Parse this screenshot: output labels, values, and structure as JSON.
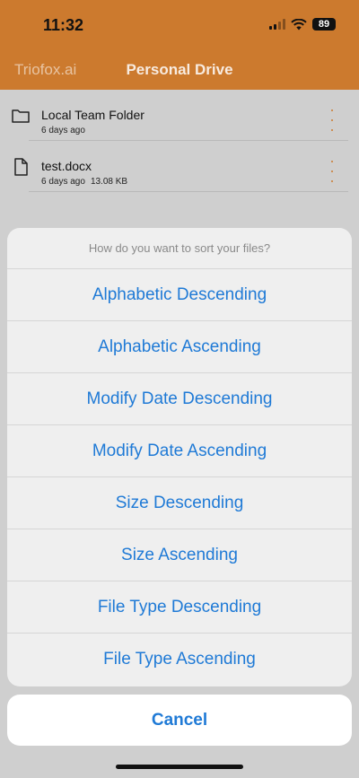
{
  "status_bar": {
    "time": "11:32",
    "battery": "89"
  },
  "nav": {
    "back_label": "Triofox.ai",
    "title": "Personal Drive"
  },
  "files": [
    {
      "name": "Local Team Folder",
      "date": "6 days ago",
      "size": "",
      "icon": "folder-icon"
    },
    {
      "name": "test.docx",
      "date": "6 days ago",
      "size": "13.08 KB",
      "icon": "document-icon"
    }
  ],
  "sort_sheet": {
    "title": "How do you want to sort your files?",
    "options": [
      "Alphabetic Descending",
      "Alphabetic Ascending",
      "Modify Date Descending",
      "Modify Date Ascending",
      "Size Descending",
      "Size Ascending",
      "File Type Descending",
      "File Type Ascending"
    ],
    "cancel_label": "Cancel"
  },
  "colors": {
    "header": "#cc7a2e",
    "accent": "#1f7ad6",
    "overlay_bg": "#cfcfcf"
  }
}
